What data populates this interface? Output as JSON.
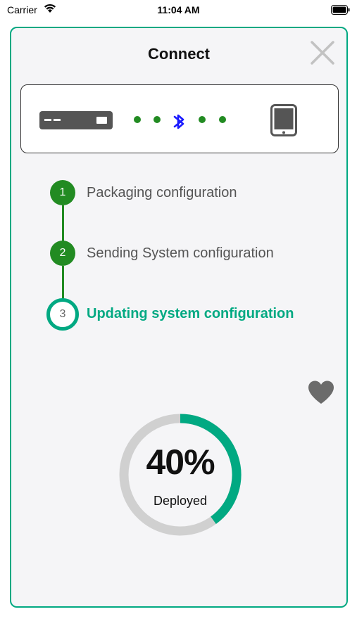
{
  "status_bar": {
    "carrier": "Carrier",
    "time": "11:04 AM"
  },
  "dialog": {
    "title": "Connect",
    "close_icon": "close-icon"
  },
  "connection": {
    "source_icon": "server-icon",
    "link_icon": "bluetooth-icon",
    "target_icon": "tablet-icon"
  },
  "steps": [
    {
      "number": "1",
      "label": "Packaging configuration",
      "state": "done"
    },
    {
      "number": "2",
      "label": "Sending System configuration",
      "state": "done"
    },
    {
      "number": "3",
      "label": "Updating system configuration",
      "state": "active"
    }
  ],
  "favorite_icon": "heart-icon",
  "progress": {
    "percent_text": "40%",
    "value": 0.4,
    "caption": "Deployed"
  },
  "colors": {
    "accent": "#01a982",
    "step_done": "#228b22",
    "ring_track": "#d0d0d0",
    "bluetooth": "#1a1aff"
  }
}
